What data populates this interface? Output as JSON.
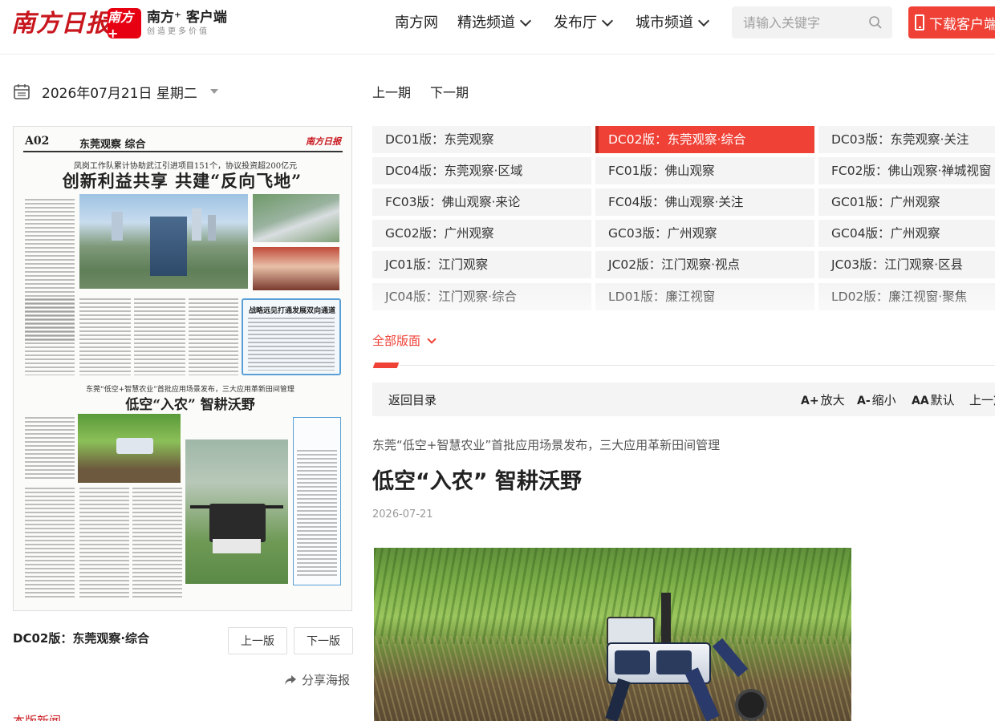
{
  "header": {
    "logo_main": "南方日报",
    "logo_badge": "南方+",
    "logo_client": "南方⁺ 客户端",
    "logo_slogan": "创造更多价值",
    "nav": [
      {
        "label": "南方网",
        "has_dropdown": false
      },
      {
        "label": "精选频道",
        "has_dropdown": true
      },
      {
        "label": "发布厅",
        "has_dropdown": true
      },
      {
        "label": "城市频道",
        "has_dropdown": true
      }
    ],
    "search_placeholder": "请输入关键字",
    "download_label": "下载客户端"
  },
  "left": {
    "date": "2026年07月21日 星期二",
    "paper": {
      "page_label": "A02",
      "column": "东莞观察 综合",
      "masthead": "南方日报",
      "subhead1": "凤岗工作队累计协助武江引进项目151个，协议投资超200亿元",
      "headline1": "创新利益共享 共建“反向飞地”",
      "box_title": "战略远见打通发展双向通道",
      "subhead2": "东莞“低空+智慧农业”首批应用场景发布，三大应用革新田间管理",
      "headline2": "低空“入农” 智耕沃野"
    },
    "edition_name": "DC02版：东莞观察·综合",
    "prev_page": "上一版",
    "next_page": "下一版",
    "share_label": "分享海报",
    "bottom_link": "本版新闻"
  },
  "right": {
    "prev_issue": "上一期",
    "next_issue": "下一期",
    "editions": [
      [
        "DC01版：东莞观察",
        "DC02版：东莞观察·综合",
        "DC03版：东莞观察·关注"
      ],
      [
        "DC04版：东莞观察·区域",
        "FC01版：佛山观察",
        "FC02版：佛山观察·禅城视窗"
      ],
      [
        "FC03版：佛山观察·来论",
        "FC04版：佛山观察·关注",
        "GC01版：广州观察"
      ],
      [
        "GC02版：广州观察",
        "GC03版：广州观察",
        "GC04版：广州观察"
      ],
      [
        "JC01版：江门观察",
        "JC02版：江门观察·视点",
        "JC03版：江门观察·区县"
      ],
      [
        "JC04版：江门观察·综合",
        "LD01版：廉江视窗",
        "LD02版：廉江视窗·聚焦"
      ]
    ],
    "active_edition": "DC02版：东莞观察·综合",
    "all_editions": "全部版面",
    "toolbar": {
      "back": "返回目录",
      "zoom_in_mark": "A+",
      "zoom_in": "放大",
      "zoom_out_mark": "A-",
      "zoom_out": "缩小",
      "default_mark": "AA",
      "default": "默认",
      "prev": "上一篇"
    },
    "article": {
      "subtitle": "东莞“低空+智慧农业”首批应用场景发布，三大应用革新田间管理",
      "title": "低空“入农” 智耕沃野",
      "date": "2026-07-21"
    }
  },
  "colors": {
    "brand_red": "#ef4136",
    "logo_red": "#c8161d",
    "tile_bg": "#f4f4f4"
  }
}
